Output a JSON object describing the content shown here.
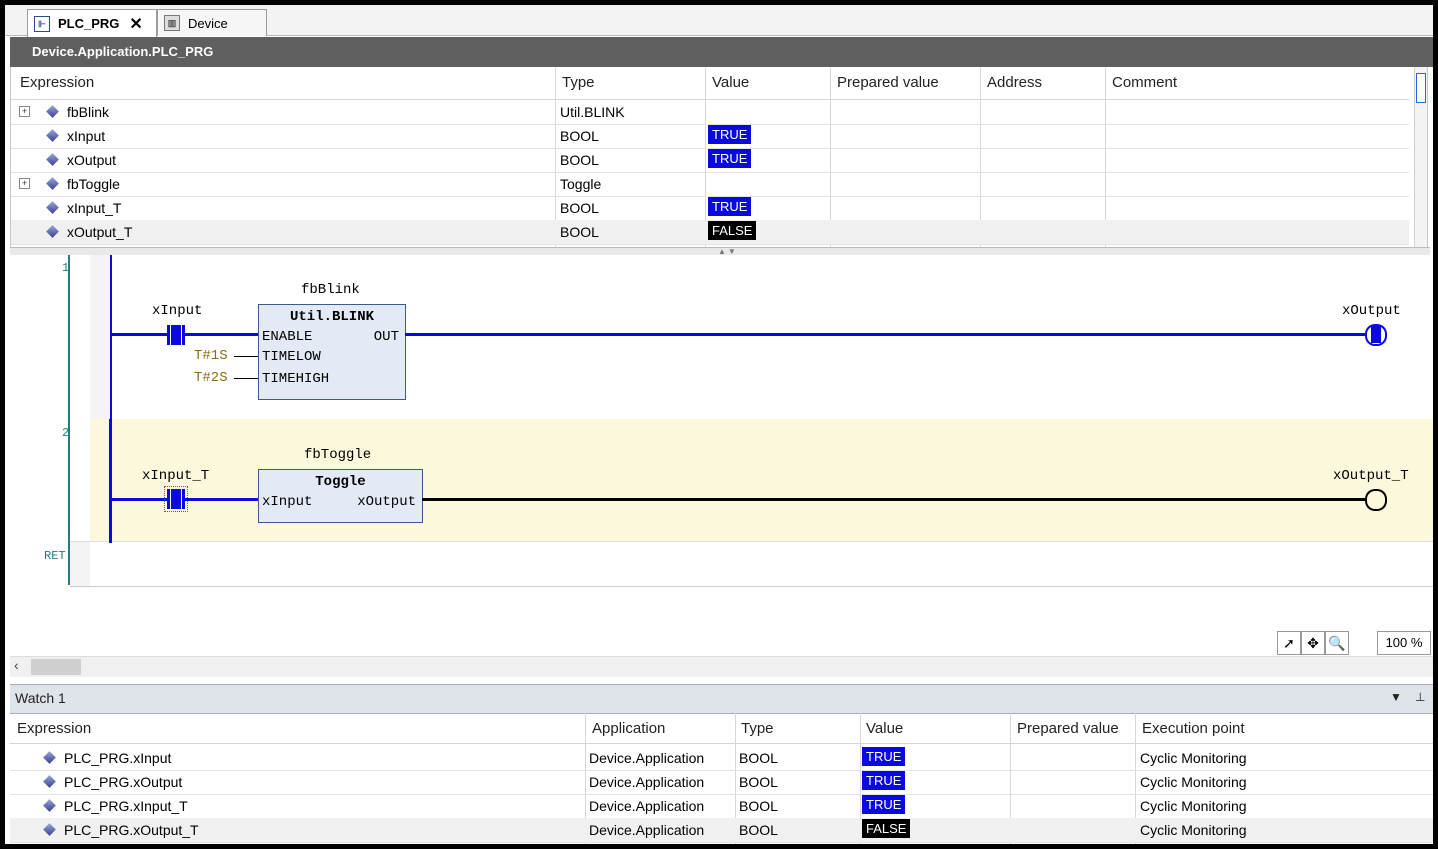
{
  "tabs": [
    {
      "label": "PLC_PRG",
      "icon": "ladder-pou-icon",
      "active": true
    },
    {
      "label": "Device",
      "icon": "device-icon",
      "active": false
    }
  ],
  "path": "Device.Application.PLC_PRG",
  "monitor": {
    "columns": [
      "Expression",
      "Type",
      "Value",
      "Prepared value",
      "Address",
      "Comment"
    ],
    "rows": [
      {
        "expr": "fbBlink",
        "type": "Util.BLINK",
        "value": "",
        "expandable": true
      },
      {
        "expr": "xInput",
        "type": "BOOL",
        "value": "TRUE",
        "expandable": false
      },
      {
        "expr": "xOutput",
        "type": "BOOL",
        "value": "TRUE",
        "expandable": false
      },
      {
        "expr": "fbToggle",
        "type": "Toggle",
        "value": "",
        "expandable": true
      },
      {
        "expr": "xInput_T",
        "type": "BOOL",
        "value": "TRUE",
        "expandable": false
      },
      {
        "expr": "xOutput_T",
        "type": "BOOL",
        "value": "FALSE",
        "expandable": false
      }
    ]
  },
  "ladder": {
    "networks": [
      {
        "number": "1",
        "contact": "xInput",
        "instance": "fbBlink",
        "fb_type": "Util.BLINK",
        "inputs": [
          "ENABLE",
          "TIMELOW",
          "TIMEHIGH"
        ],
        "output_pin": "OUT",
        "constants": [
          "T#1S",
          "T#2S"
        ],
        "coil": "xOutput"
      },
      {
        "number": "2",
        "contact": "xInput_T",
        "instance": "fbToggle",
        "fb_type": "Toggle",
        "input_pin": "xInput",
        "output_pin": "xOutput",
        "coil": "xOutput_T"
      }
    ],
    "ret_label": "RET",
    "zoom": "100 %",
    "colors": {
      "powered": "#0a0ae0",
      "unpowered": "#000000",
      "network2_bg": "#fbf8dc"
    }
  },
  "watch": {
    "title": "Watch 1",
    "pin_icon": "pin-icon",
    "dropdown_icon": "dropdown-icon",
    "columns": [
      "Expression",
      "Application",
      "Type",
      "Value",
      "Prepared value",
      "Execution point"
    ],
    "rows": [
      {
        "expr": "PLC_PRG.xInput",
        "app": "Device.Application",
        "type": "BOOL",
        "value": "TRUE",
        "exec": "Cyclic Monitoring"
      },
      {
        "expr": "PLC_PRG.xOutput",
        "app": "Device.Application",
        "type": "BOOL",
        "value": "TRUE",
        "exec": "Cyclic Monitoring"
      },
      {
        "expr": "PLC_PRG.xInput_T",
        "app": "Device.Application",
        "type": "BOOL",
        "value": "TRUE",
        "exec": "Cyclic Monitoring"
      },
      {
        "expr": "PLC_PRG.xOutput_T",
        "app": "Device.Application",
        "type": "BOOL",
        "value": "FALSE",
        "exec": "Cyclic Monitoring"
      }
    ]
  }
}
